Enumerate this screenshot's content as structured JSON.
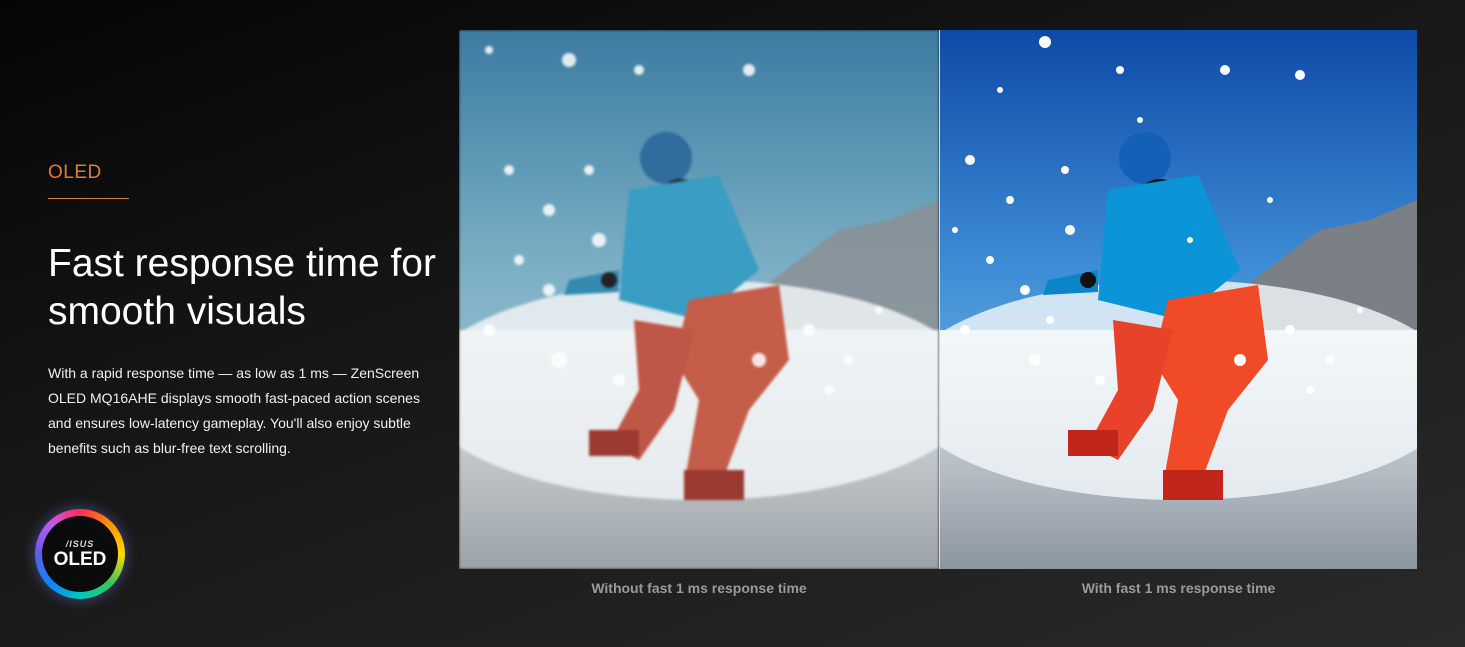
{
  "section": {
    "eyebrow": "OLED",
    "headline": "Fast response time for smooth visuals",
    "body": "With a rapid response time — as low as 1 ms — ZenScreen OLED MQ16AHE displays smooth fast-paced action scenes and ensures low-latency gameplay. You'll also enjoy subtle benefits such as blur-free text scrolling."
  },
  "badge": {
    "brand": "/ISUS",
    "label": "OLED"
  },
  "comparison": {
    "left_caption": "Without fast 1 ms response time",
    "right_caption": "With fast 1 ms response time"
  },
  "colors": {
    "accent": "#e27b3a",
    "caption": "#9a9a9a",
    "background": "#161616"
  }
}
